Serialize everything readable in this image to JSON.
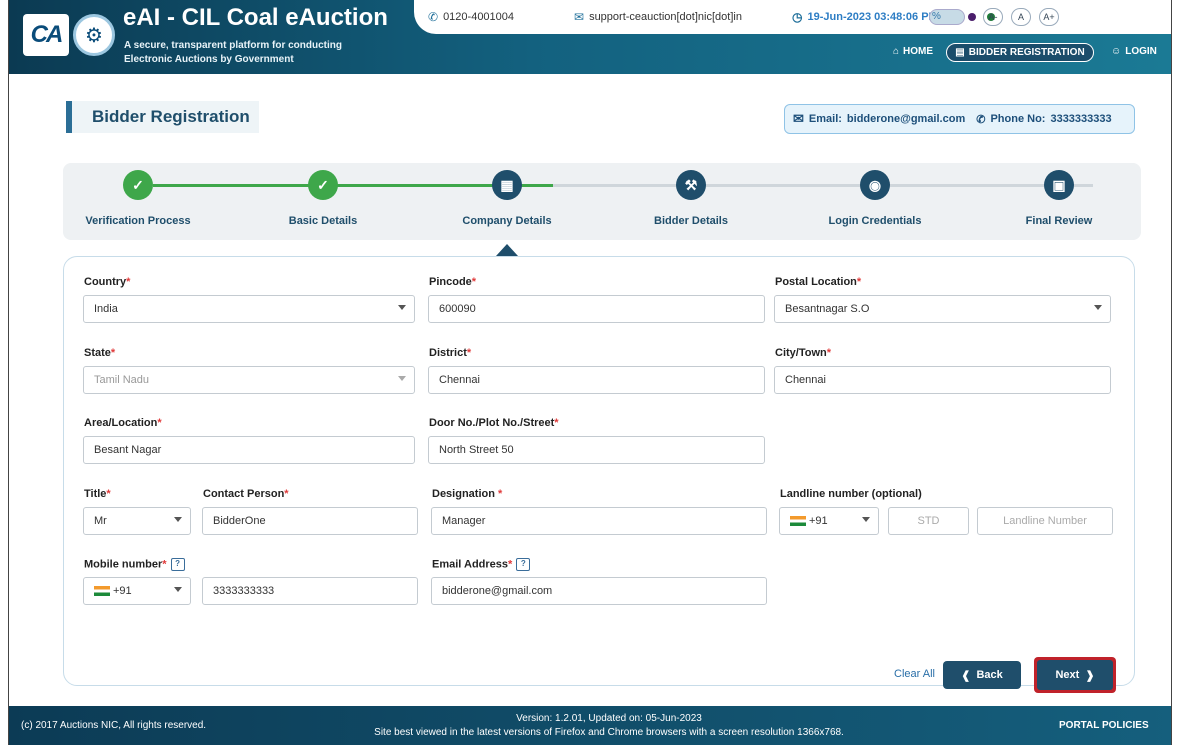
{
  "header": {
    "logo_text": "CA",
    "title": "eAI - CIL Coal eAuction",
    "tagline_line1": "A secure, transparent platform for conducting",
    "tagline_line2": "Electronic Auctions by Government",
    "phone": "0120-4001004",
    "email": "support-ceauction[dot]nic[dot]in",
    "datetime": "19-Jun-2023 03:48:06 PM",
    "theme_colors": [
      "#2a6fb0",
      "#4a1e6b",
      "#1f7a3a"
    ],
    "font_sizes": [
      "A-",
      "A",
      "A+"
    ],
    "nav": {
      "home": "HOME",
      "bidder_registration": "BIDDER REGISTRATION",
      "login": "LOGIN"
    }
  },
  "page": {
    "title": "Bidder Registration",
    "contact_email_label": "Email:",
    "contact_email": "bidderone@gmail.com",
    "contact_phone_label": "Phone No:",
    "contact_phone": "3333333333"
  },
  "steps": [
    {
      "label": "Verification Process",
      "status": "done"
    },
    {
      "label": "Basic Details",
      "status": "done"
    },
    {
      "label": "Company Details",
      "status": "current"
    },
    {
      "label": "Bidder Details",
      "status": "pending"
    },
    {
      "label": "Login Credentials",
      "status": "pending"
    },
    {
      "label": "Final Review",
      "status": "pending"
    }
  ],
  "form": {
    "country": {
      "label": "Country",
      "value": "India"
    },
    "pincode": {
      "label": "Pincode",
      "value": "600090"
    },
    "postal_location": {
      "label": "Postal Location",
      "value": "Besantnagar S.O"
    },
    "state": {
      "label": "State",
      "value": "Tamil Nadu"
    },
    "district": {
      "label": "District",
      "value": "Chennai"
    },
    "city": {
      "label": "City/Town",
      "value": "Chennai"
    },
    "area": {
      "label": "Area/Location",
      "value": "Besant Nagar"
    },
    "door": {
      "label": "Door No./Plot No./Street",
      "value": "North Street 50"
    },
    "title": {
      "label": "Title",
      "value": "Mr"
    },
    "contact_person": {
      "label": "Contact Person",
      "value": "BidderOne"
    },
    "designation": {
      "label": "Designation ",
      "value": "Manager"
    },
    "landline": {
      "label": "Landline number (optional)",
      "code": "+91",
      "std_placeholder": "STD",
      "number_placeholder": "Landline Number"
    },
    "mobile": {
      "label": "Mobile number",
      "code": "+91",
      "value": "3333333333"
    },
    "email": {
      "label": "Email Address",
      "value": "bidderone@gmail.com"
    }
  },
  "buttons": {
    "clear": "Clear All",
    "back": "Back",
    "next": "Next"
  },
  "footer": {
    "copyright": "(c) 2017 Auctions NIC, All rights reserved.",
    "version": "Version: 1.2.01, Updated on: 05-Jun-2023",
    "browser_note": "Site best viewed in the latest versions of Firefox and Chrome browsers with a screen resolution 1366x768.",
    "policies": "PORTAL POLICIES"
  },
  "colors": {
    "accent": "#1f4e6b",
    "done": "#3ea74a",
    "next_border": "#c0222a"
  }
}
